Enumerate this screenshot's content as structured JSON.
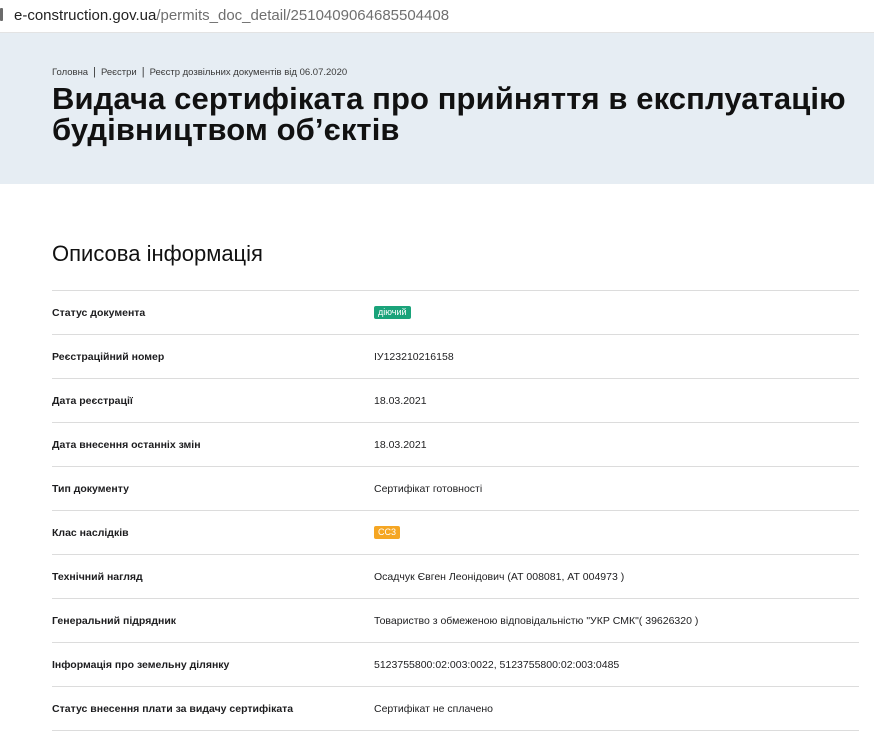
{
  "browser": {
    "url_host": "e-construction.gov.ua",
    "url_path": "/permits_doc_detail/2510409064685504408"
  },
  "breadcrumb": [
    "Головна",
    "Реєстри",
    "Реєстр дозвільних документів від 06.07.2020"
  ],
  "page": {
    "title_line1": "Видача сертифіката про прийняття в експлуатацію",
    "title_line2": "будівництвом об’єктів"
  },
  "section": {
    "title": "Описова інформація"
  },
  "colors": {
    "hero_bg": "#e6edf3",
    "status_badge": "#1aa37a",
    "class_badge": "#f5a623"
  },
  "rows": [
    {
      "label": "Статус документа",
      "value": "діючий",
      "kind": "badge-green"
    },
    {
      "label": "Реєстраційний номер",
      "value": "ІУ123210216158",
      "kind": "text"
    },
    {
      "label": "Дата реєстрації",
      "value": "18.03.2021",
      "kind": "text"
    },
    {
      "label": "Дата внесення останніх змін",
      "value": "18.03.2021",
      "kind": "text"
    },
    {
      "label": "Тип документу",
      "value": "Сертифікат готовності",
      "kind": "text"
    },
    {
      "label": "Клас наслідків",
      "value": "СС3",
      "kind": "badge-orange"
    },
    {
      "label": "Технічний нагляд",
      "value": "Осадчук Євген Леонідович (АТ 008081, АТ 004973 )",
      "kind": "text"
    },
    {
      "label": "Генеральний підрядник",
      "value": "Товариство з обмеженою відповідальністю \"УКР СМК\"( 39626320 )",
      "kind": "text"
    },
    {
      "label": "Інформація про земельну ділянку",
      "value": "5123755800:02:003:0022, 5123755800:02:003:0485",
      "kind": "text"
    },
    {
      "label": "Статус внесення плати за видачу сертифіката",
      "value": "Сертифікат не сплачено",
      "kind": "text"
    }
  ]
}
